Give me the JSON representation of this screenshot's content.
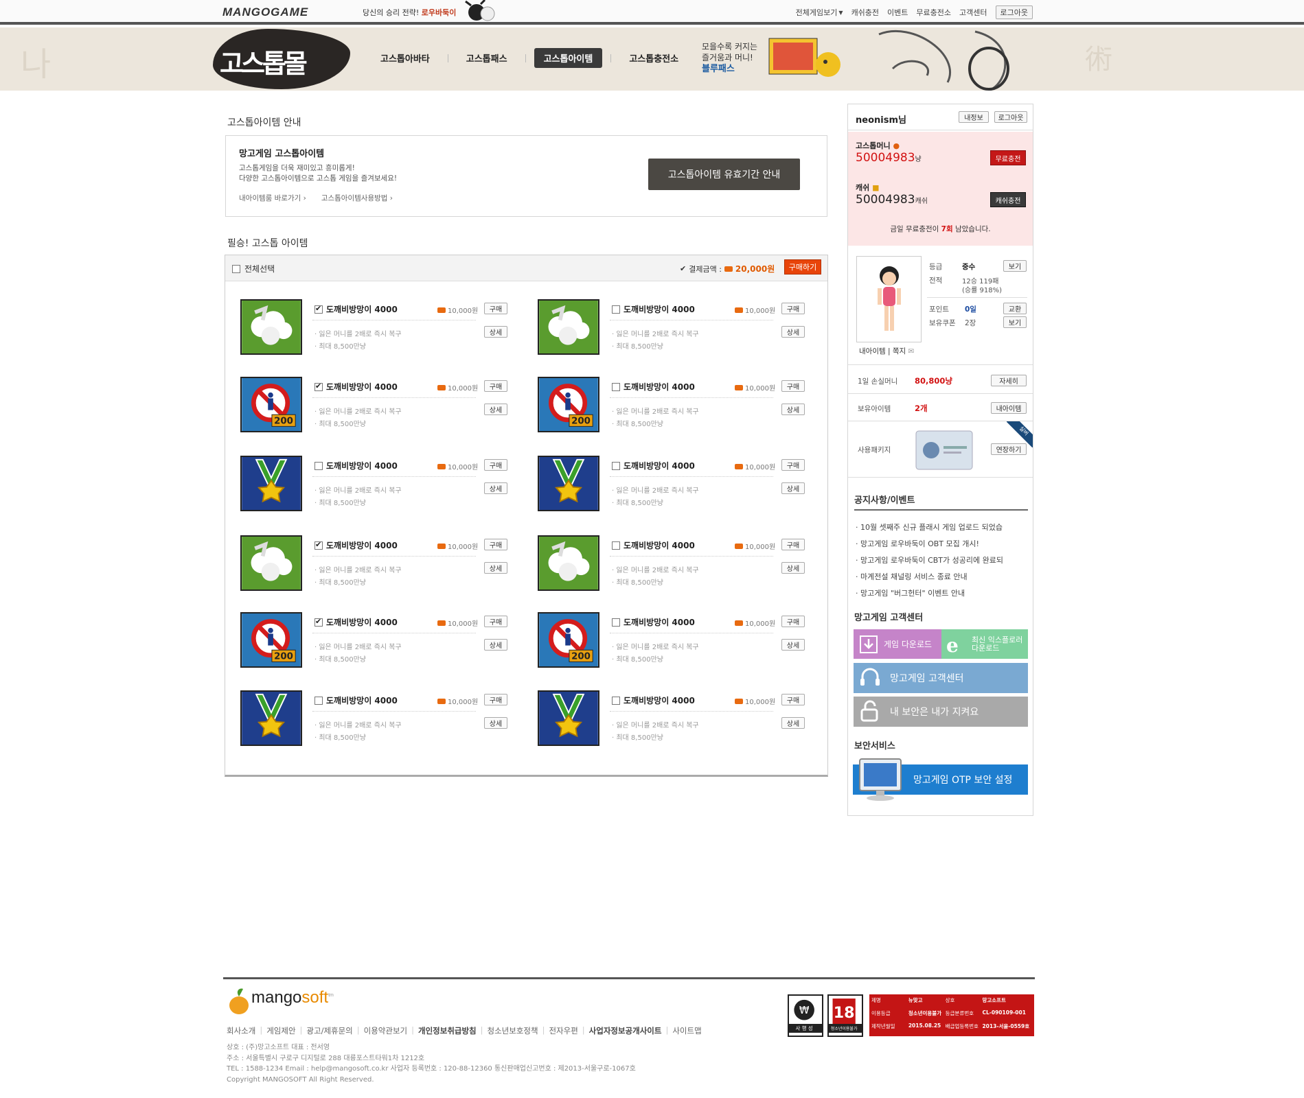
{
  "topbar": {
    "logo": "MANGOGAME",
    "promo_text": "당신의 승리 전략!",
    "promo_link": "로우바둑이",
    "nav": [
      "전체게임보기",
      "캐쉬충전",
      "이벤트",
      "무료충전소",
      "고객센터"
    ],
    "logout": "로그아웃"
  },
  "header": {
    "shop_logo": "고스톱몰",
    "nav": [
      "고스톱아바타",
      "고스톱패스",
      "고스톱아이템",
      "고스톱충전소"
    ],
    "active_nav": "고스톱아이템",
    "bluepass_line1": "모을수록 커지는",
    "bluepass_line2": "즐거움과 머니!",
    "bluepass_title": "블루패스"
  },
  "guide": {
    "section_title": "고스톱아이템 안내",
    "title": "망고게임 고스톱아이템",
    "desc1": "고스톱게임을 더욱 재미있고 흥미롭게!",
    "desc2": "다양한 고스톱아이템으로 고스톱 게임을 즐겨보세요!",
    "link1": "내아이템룸 바로가기",
    "link2": "고스톱아이템사용방법",
    "button": "고스톱아이템 유효기간 안내"
  },
  "items_section": {
    "title": "필승! 고스톱 아이템",
    "select_all": "전체선택",
    "pay_label": "결제금액 :",
    "pay_amount": "20,000원",
    "buy_all": "구매하기",
    "buy": "구매",
    "detail": "상세",
    "items": [
      {
        "name": "도깨비방망이 4000",
        "price": "10,000원",
        "desc1": "· 잃은 머니를 2배로 즉시 복구",
        "desc2": "· 최대 8,500만냥",
        "icon": "cloud-icon",
        "checked": true
      },
      {
        "name": "도깨비방망이 4000",
        "price": "10,000원",
        "desc1": "· 잃은 머니를 2배로 즉시 복구",
        "desc2": "· 최대 8,500만냥",
        "icon": "cloud-icon",
        "checked": false
      },
      {
        "name": "도깨비방망이 4000",
        "price": "10,000원",
        "desc1": "· 잃은 머니를 2배로 즉시 복구",
        "desc2": "· 최대 8,500만냥",
        "icon": "no-entry-icon",
        "checked": true
      },
      {
        "name": "도깨비방망이 4000",
        "price": "10,000원",
        "desc1": "· 잃은 머니를 2배로 즉시 복구",
        "desc2": "· 최대 8,500만냥",
        "icon": "no-entry-icon",
        "checked": false
      },
      {
        "name": "도깨비방망이 4000",
        "price": "10,000원",
        "desc1": "· 잃은 머니를 2배로 즉시 복구",
        "desc2": "· 최대 8,500만냥",
        "icon": "medal-icon",
        "checked": false
      },
      {
        "name": "도깨비방망이 4000",
        "price": "10,000원",
        "desc1": "· 잃은 머니를 2배로 즉시 복구",
        "desc2": "· 최대 8,500만냥",
        "icon": "medal-icon",
        "checked": false
      },
      {
        "name": "도깨비방망이 4000",
        "price": "10,000원",
        "desc1": "· 잃은 머니를 2배로 즉시 복구",
        "desc2": "· 최대 8,500만냥",
        "icon": "cloud-icon",
        "checked": true
      },
      {
        "name": "도깨비방망이 4000",
        "price": "10,000원",
        "desc1": "· 잃은 머니를 2배로 즉시 복구",
        "desc2": "· 최대 8,500만냥",
        "icon": "cloud-icon",
        "checked": false
      },
      {
        "name": "도깨비방망이 4000",
        "price": "10,000원",
        "desc1": "· 잃은 머니를 2배로 즉시 복구",
        "desc2": "· 최대 8,500만냥",
        "icon": "no-entry-icon",
        "checked": true
      },
      {
        "name": "도깨비방망이 4000",
        "price": "10,000원",
        "desc1": "· 잃은 머니를 2배로 즉시 복구",
        "desc2": "· 최대 8,500만냥",
        "icon": "no-entry-icon",
        "checked": false
      },
      {
        "name": "도깨비방망이 4000",
        "price": "10,000원",
        "desc1": "· 잃은 머니를 2배로 즉시 복구",
        "desc2": "· 최대 8,500만냥",
        "icon": "medal-icon",
        "checked": false
      },
      {
        "name": "도깨비방망이 4000",
        "price": "10,000원",
        "desc1": "· 잃은 머니를 2배로 즉시 복구",
        "desc2": "· 최대 8,500만냥",
        "icon": "medal-icon",
        "checked": false
      }
    ]
  },
  "user": {
    "name": "neonism님",
    "my_info": "내정보",
    "logout": "로그아웃",
    "gostop_money_label": "고스톱머니",
    "gostop_money": "50004983",
    "money_unit": "냥",
    "free_charge": "무료충전",
    "cash_label": "캐쉬",
    "cash": "50004983",
    "cash_unit": "캐쉬",
    "cash_charge": "캐쉬충전",
    "free_count_pre": "금일 무료충전이",
    "free_count": "7회",
    "free_count_post": "남았습니다.",
    "grade_label": "등급",
    "grade": "중수",
    "record_label": "전적",
    "record": "12승 119패",
    "win_rate": "(승률 918%)",
    "point_label": "포인트",
    "point": "0일",
    "coupon_label": "보유쿠폰",
    "coupon": "2장",
    "view": "보기",
    "exchange": "교환",
    "my_items": "내아이템",
    "memo": "쪽지",
    "daily_loss_label": "1일 손실머니",
    "daily_loss": "80,800냥",
    "detail": "자세히",
    "own_items_label": "보유아이템",
    "own_items": "2개",
    "my_item_btn": "내아이템",
    "package_label": "사용패키지",
    "extend": "연장하기",
    "ribbon": "실버"
  },
  "notice": {
    "title": "공지사항/이벤트",
    "items": [
      "10월 셋째주 신규 플래시 게임 업로드 되었습",
      "망고게임 로우바둑이 OBT 모집 개시!",
      "망고게임 로우바둑이 CBT가 성공리에 완료되",
      "마계전설 채널링 서비스 종료 안내",
      "망고게임 \"버그헌터\" 이벤트 안내"
    ]
  },
  "cs": {
    "title": "망고게임 고객센터",
    "download": "게임 다운로드",
    "ie1": "최신 익스플로러",
    "ie2": "다운로드",
    "center": "망고게임 고객센터",
    "security": "내 보안은 내가 지켜요",
    "colors": {
      "download": "#c584c9",
      "ie": "#7fd29e",
      "center": "#7aa9d2",
      "security": "#a9a9a9"
    }
  },
  "security": {
    "title": "보안서비스",
    "otp": "망고게임 OTP 보안 설정"
  },
  "footer": {
    "logo1": "mango",
    "logo2": "soft",
    "links": [
      "회사소개",
      "게임제안",
      "광고/제휴문의",
      "이용약관보기",
      "개인정보취급방침",
      "청소년보호정책",
      "전자우편",
      "사업자정보공개사이트",
      "사이트맵"
    ],
    "info1": "상호 : (주)망고소프트 대표 : 전서영",
    "info2": "주소 : 서울특별시 구로구 디지털로 288 대륭포스트타워1차 1212호",
    "info3": "TEL : 1588-1234 Email : help@mangosoft.co.kr 사업자 등록번호 : 120-88-12360 통신판매업신고번호 : 제2013-서울구로-1067호",
    "info4": "Copyright MANGOSOFT All Right Reserved.",
    "rate1": "사 행 성",
    "rate2": "청소년이용불가",
    "rating": [
      "제명",
      "뉴맞고",
      "상호",
      "망고소프트",
      "이용등급",
      "청소년이용불가",
      "등급분류번호",
      "CL-090109-001",
      "제작년월일",
      "2015.08.25",
      "배급업등록번호",
      "2013-서울-0559호"
    ]
  }
}
